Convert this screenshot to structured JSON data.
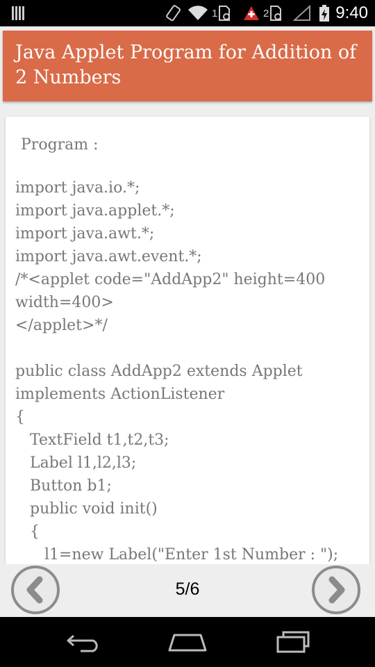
{
  "status_bar": {
    "sim1_label": "1",
    "sim2_label": "2",
    "time": "9:40"
  },
  "header": {
    "title": "Java Applet Program for Addition of 2 Numbers"
  },
  "card": {
    "program_label": "Program :",
    "code_lines": [
      "import java.io.*;",
      "import java.applet.*;",
      "import java.awt.*;",
      "import java.awt.event.*;",
      "/*<applet code=\"AddApp2\" height=400 width=400>",
      "</applet>*/",
      "",
      "public class AddApp2 extends Applet implements ActionListener",
      "{",
      "   TextField t1,t2,t3;",
      "   Label l1,l2,l3;",
      "   Button b1;",
      "   public void init()",
      "   {",
      "      l1=new Label(\"Enter 1st Number : \");"
    ]
  },
  "navigation": {
    "page_indicator": "5/6",
    "prev_icon": "chevron-left-icon",
    "next_icon": "chevron-right-icon"
  },
  "system_nav": {
    "back_icon": "back-icon",
    "home_icon": "home-icon",
    "recents_icon": "recents-icon"
  },
  "colors": {
    "header_bg": "#d96b48",
    "code_text": "#777777",
    "nav_circle": "#8c8c8c"
  }
}
